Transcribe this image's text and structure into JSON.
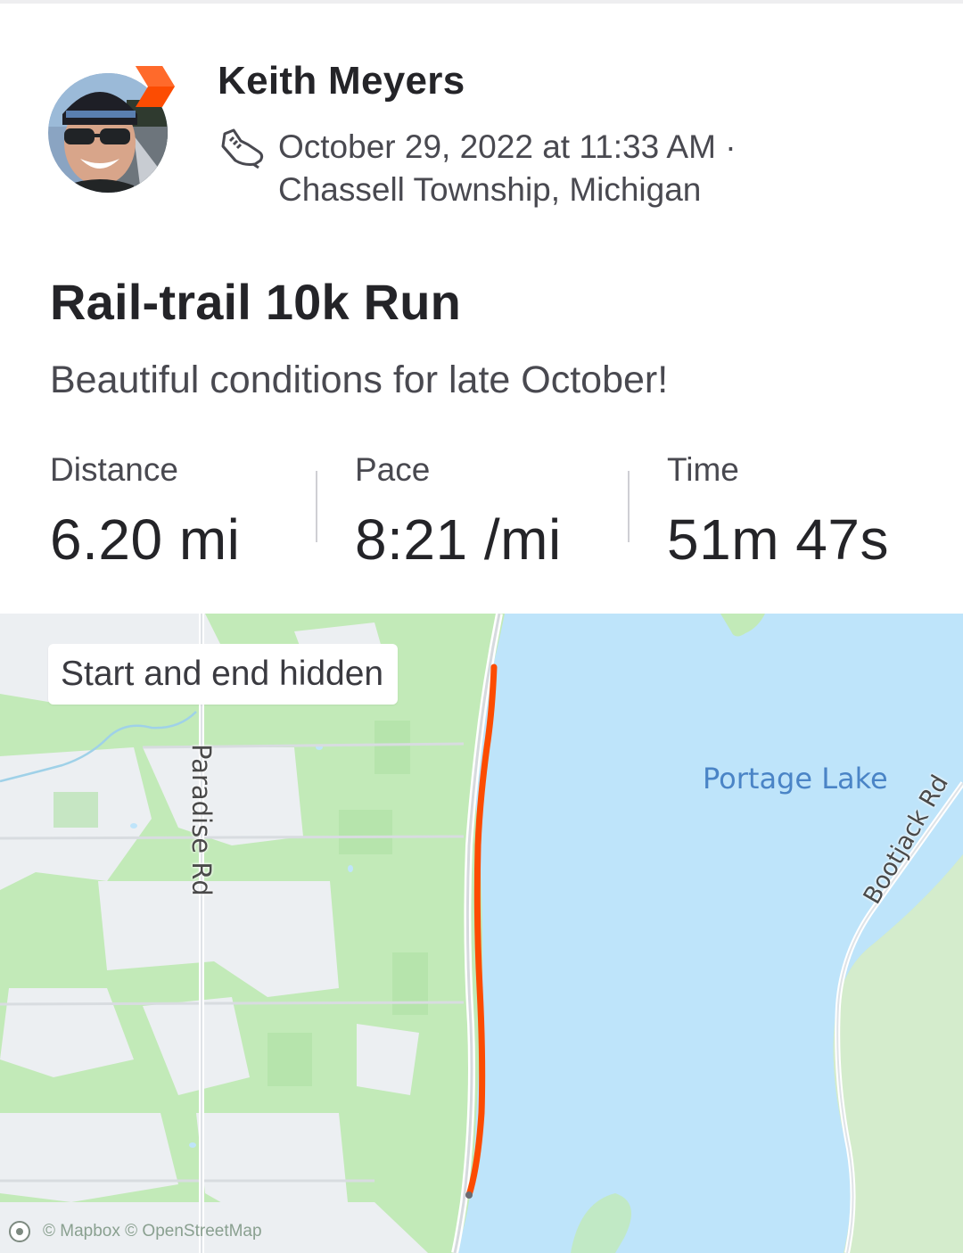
{
  "athlete": {
    "name": "Keith Meyers",
    "date": "October 29, 2022 at 11:33 AM ·",
    "location": "Chassell Township, Michigan"
  },
  "activity": {
    "title": "Rail-trail 10k Run",
    "description": "Beautiful conditions for late October!",
    "icon": "running-shoe-icon"
  },
  "stats": [
    {
      "label": "Distance",
      "value": "6.20 mi"
    },
    {
      "label": "Pace",
      "value": "8:21 /mi"
    },
    {
      "label": "Time",
      "value": "51m 47s"
    }
  ],
  "map": {
    "privacy_label": "Start and end hidden",
    "labels": {
      "lake": "Portage Lake",
      "road_west": "Paradise Rd",
      "road_east": "Bootjack Rd"
    },
    "attribution": "© Mapbox © OpenStreetMap",
    "colors": {
      "route": "#fc4c02",
      "water": "#bfe4fa",
      "forest": "#bde8b4",
      "open_land": "#eef1f4"
    }
  },
  "colors": {
    "brand": "#fc4c02",
    "text_primary": "#242428",
    "text_secondary": "#494950"
  }
}
